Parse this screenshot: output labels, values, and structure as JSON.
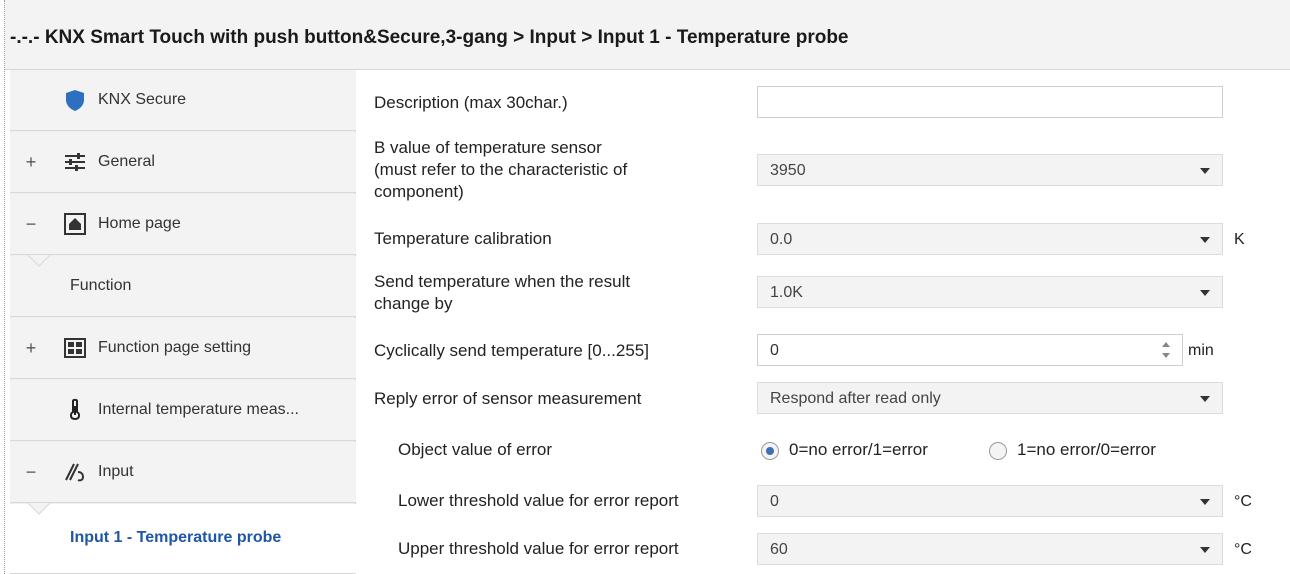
{
  "breadcrumb": "-.-.- KNX Smart Touch with push button&Secure,3-gang > Input > Input 1 - Temperature probe",
  "sidebar": {
    "items": [
      {
        "label": "KNX Secure",
        "expander": "",
        "icon": "shield-icon"
      },
      {
        "label": "General",
        "expander": "+",
        "icon": "sliders-icon"
      },
      {
        "label": "Home page",
        "expander": "−",
        "icon": "home-icon"
      },
      {
        "label": "Function",
        "expander": "",
        "icon": ""
      },
      {
        "label": "Function page setting",
        "expander": "+",
        "icon": "grid-icon"
      },
      {
        "label": "Internal temperature meas...",
        "expander": "",
        "icon": "thermometer-icon"
      },
      {
        "label": "Input",
        "expander": "−",
        "icon": "input-icon"
      },
      {
        "label": "Input 1 - Temperature probe",
        "expander": "",
        "icon": ""
      }
    ]
  },
  "params": {
    "description": {
      "label": "Description (max 30char.)",
      "value": ""
    },
    "b_value": {
      "label_lines": [
        "B value of temperature sensor",
        "(must refer to the characteristic of",
        "component)"
      ],
      "value": "3950"
    },
    "calibration": {
      "label": "Temperature calibration",
      "value": "0.0",
      "unit": "K"
    },
    "send_change": {
      "label_lines": [
        "Send temperature when the result",
        "change by"
      ],
      "value": "1.0K"
    },
    "cyclic": {
      "label": "Cyclically send temperature [0...255]",
      "value": "0",
      "unit": "min"
    },
    "reply_error": {
      "label": "Reply error of  sensor measurement",
      "value": "Respond after read only"
    },
    "object_value": {
      "label": "Object value of error",
      "options": [
        "0=no error/1=error",
        "1=no error/0=error"
      ],
      "selected": 0
    },
    "lower_threshold": {
      "label": "Lower threshold value for error report",
      "value": "0",
      "unit": "°C"
    },
    "upper_threshold": {
      "label": "Upper threshold value for error report",
      "value": "60",
      "unit": "°C"
    }
  },
  "colors": {
    "accent": "#1f56a8",
    "shield": "#2f6fc0",
    "radio": "#3b6fb6"
  }
}
